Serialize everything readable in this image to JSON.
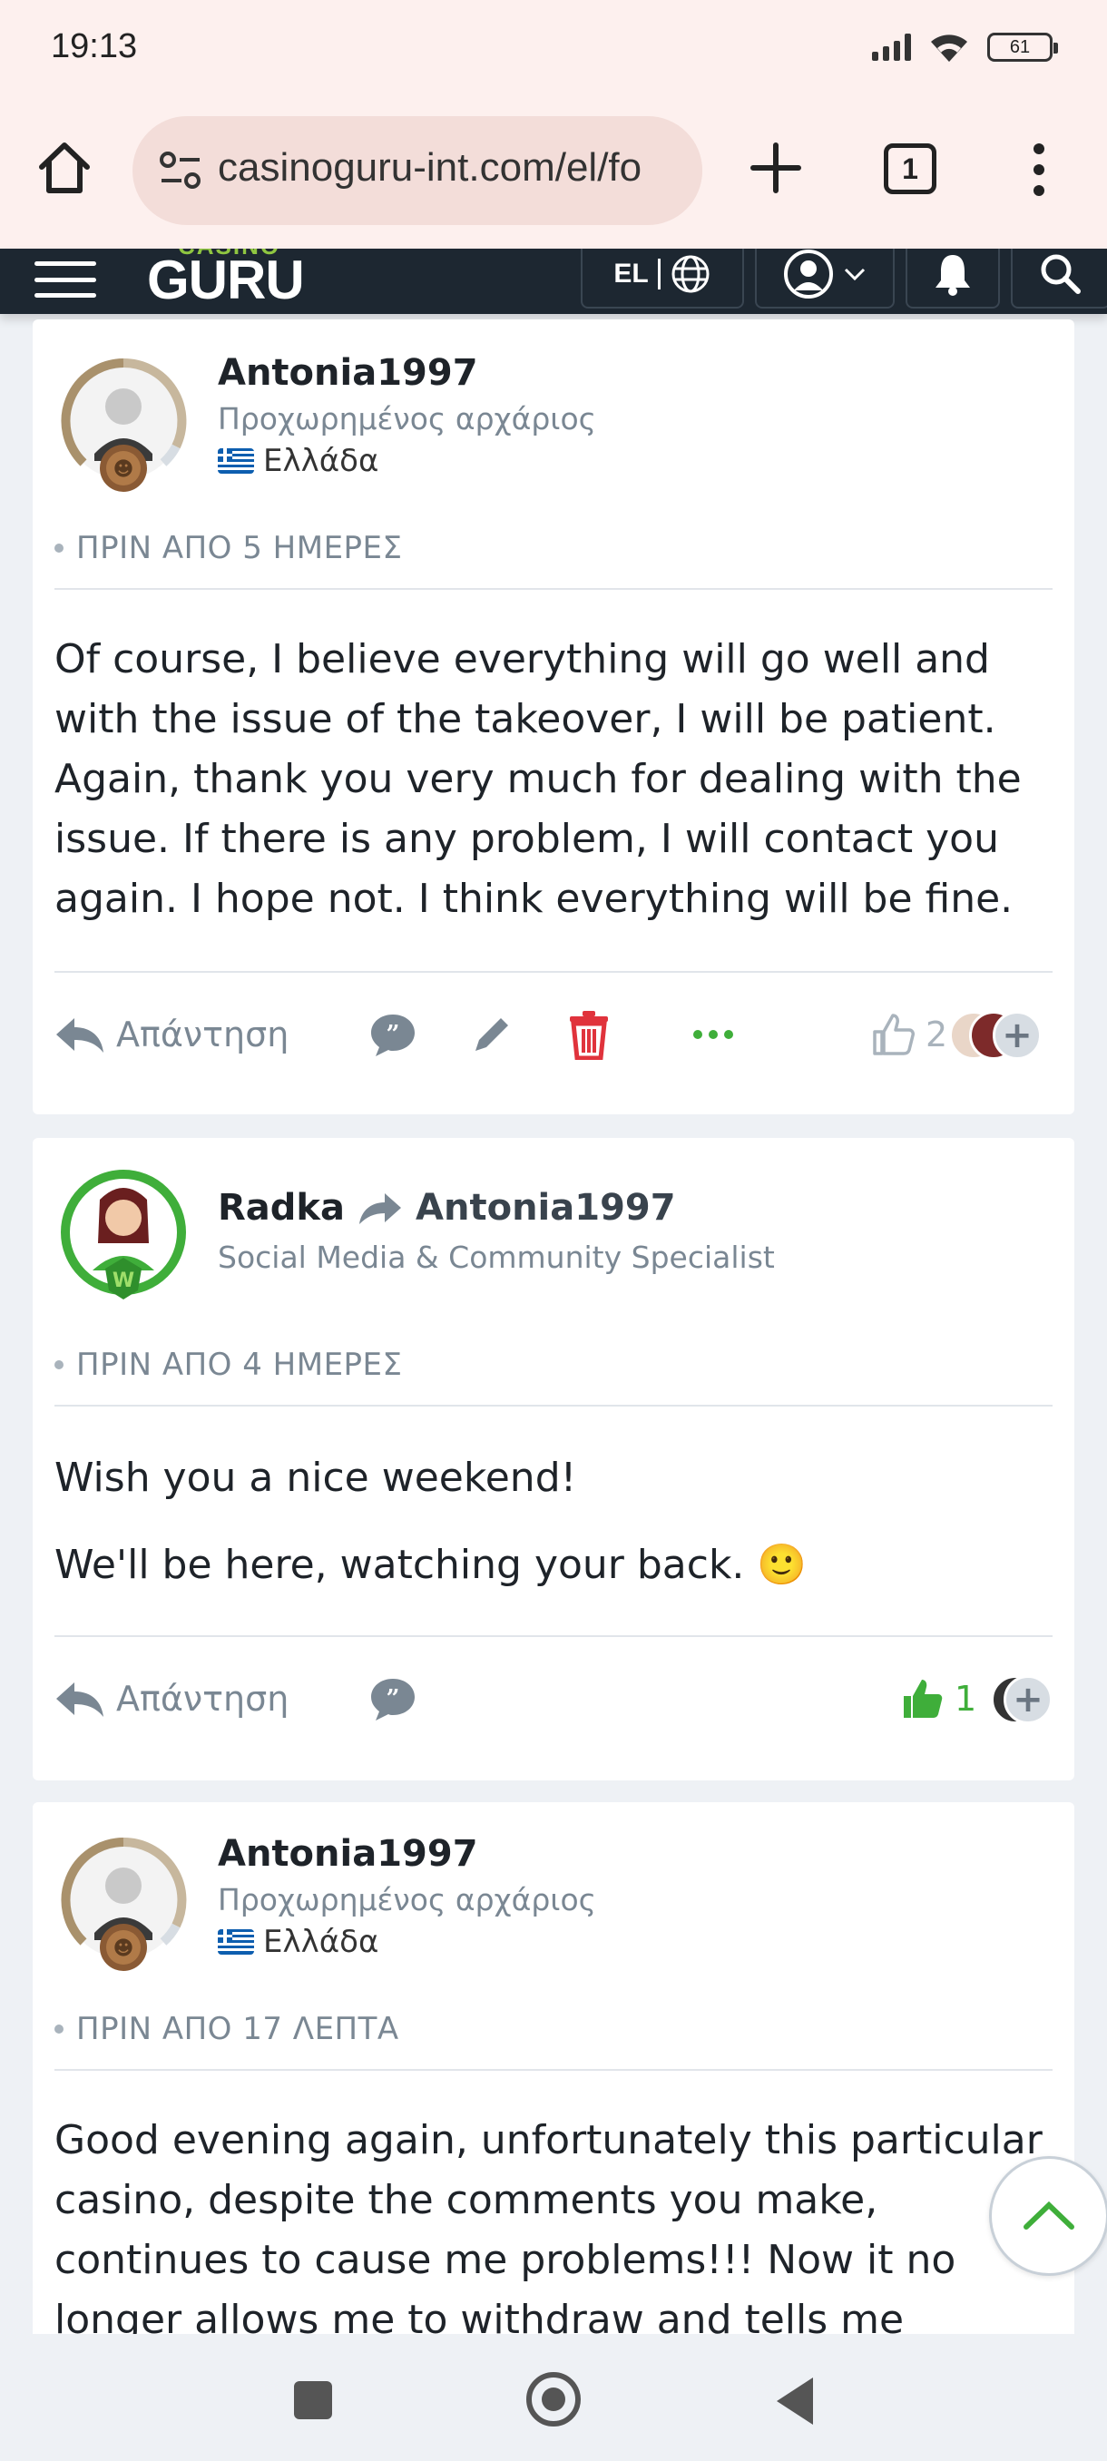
{
  "status_bar": {
    "time": "19:13",
    "battery": "61"
  },
  "browser": {
    "url": "casinoguru-int.com/el/fo",
    "tab_count": "1"
  },
  "site_header": {
    "logo_small": "CASINO",
    "logo_big": "GURU",
    "language": "EL"
  },
  "posts": [
    {
      "author": "Antonia1997",
      "rank": "Προχωρημένος αρχάριος",
      "country": "Ελλάδα",
      "time": "ΠΡΙΝ ΑΠΟ 5 ΗΜΕΡΕΣ",
      "paragraphs": [
        "Of course, I believe everything will go well and with the issue of the takeover, I will be patient. Again, thank you very much for dealing with the issue. If there is any problem, I will contact you again. I hope not. I think everything will be fine."
      ],
      "reply_label": "Απάντηση",
      "likes": "2"
    },
    {
      "author": "Radka",
      "reply_to": "Antonia1997",
      "rank": "Social Media & Community Specialist",
      "time": "ΠΡΙΝ ΑΠΟ 4 ΗΜΕΡΕΣ",
      "paragraphs": [
        "Wish you a nice weekend!",
        "We'll be here, watching your back. 🙂"
      ],
      "reply_label": "Απάντηση",
      "likes": "1"
    },
    {
      "author": "Antonia1997",
      "rank": "Προχωρημένος αρχάριος",
      "country": "Ελλάδα",
      "time": "ΠΡΙΝ ΑΠΟ 17 ΛΕΠΤΑ",
      "paragraphs": [
        "Good evening again, unfortunately this particular casino, despite the comments you make, continues to cause me problems!!! Now it no longer allows me to withdraw and tells me"
      ]
    }
  ],
  "colors": {
    "header_bg": "#1d2731",
    "accent_green": "#3fae3a",
    "delete_red": "#e0333c",
    "muted": "#7a8793"
  }
}
